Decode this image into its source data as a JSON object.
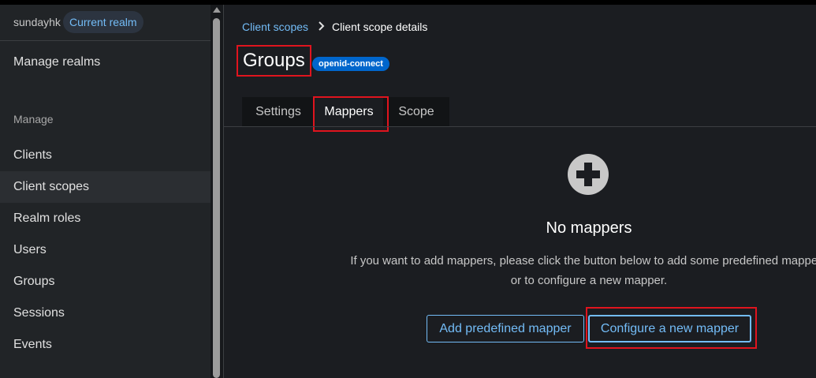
{
  "sidebar": {
    "realm_name": "sundayhk",
    "realm_badge": "Current realm",
    "manage_realms": "Manage realms",
    "section_label": "Manage",
    "items": [
      {
        "label": "Clients"
      },
      {
        "label": "Client scopes"
      },
      {
        "label": "Realm roles"
      },
      {
        "label": "Users"
      },
      {
        "label": "Groups"
      },
      {
        "label": "Sessions"
      },
      {
        "label": "Events"
      }
    ],
    "active_item": "Client scopes"
  },
  "breadcrumb": {
    "parent": "Client scopes",
    "current": "Client scope details"
  },
  "header": {
    "title": "Groups",
    "protocol_badge": "openid-connect"
  },
  "tabs": [
    {
      "label": "Settings"
    },
    {
      "label": "Mappers"
    },
    {
      "label": "Scope"
    }
  ],
  "selected_tab": "Mappers",
  "empty_state": {
    "icon": "plus-circle-icon",
    "title": "No mappers",
    "body": "If you want to add mappers, please click the button below to add some predefined mappers or to configure a new mapper.",
    "primary_button": "Add predefined mapper",
    "secondary_button": "Configure a new mapper"
  },
  "colors": {
    "link": "#73bcf7",
    "badge": "#0066cc",
    "highlight": "#e0141e",
    "background": "#1b1d21"
  }
}
